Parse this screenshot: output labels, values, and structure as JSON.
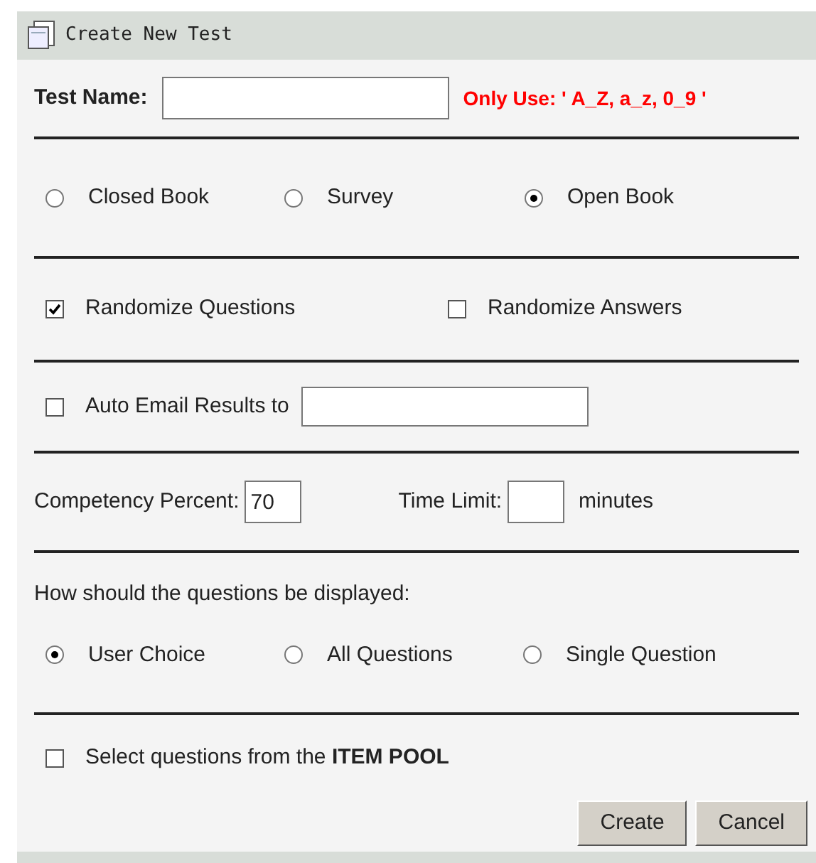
{
  "title": "Create New Test",
  "test_name": {
    "label": "Test Name:",
    "hint": "Only Use: ' A_Z, a_z, 0_9 '"
  },
  "test_types": [
    {
      "label": "Closed Book",
      "selected": false
    },
    {
      "label": "Survey",
      "selected": false
    },
    {
      "label": "Open Book",
      "selected": true
    }
  ],
  "randomize": [
    {
      "label": "Randomize Questions",
      "checked": true
    },
    {
      "label": "Randomize Answers",
      "checked": false
    }
  ],
  "auto_email": {
    "label": "Auto Email Results to",
    "checked": false
  },
  "competency": {
    "label": "Competency Percent:",
    "value": "70"
  },
  "time_limit": {
    "label": "Time Limit:",
    "unit": "minutes"
  },
  "display": {
    "prompt": "How should the questions be displayed:",
    "options": [
      {
        "label": "User Choice",
        "selected": true
      },
      {
        "label": "All Questions",
        "selected": false
      },
      {
        "label": "Single Question",
        "selected": false
      }
    ]
  },
  "item_pool": {
    "label": "Select questions from the **ITEM POOL**",
    "checked": false
  },
  "buttons": [
    "Create",
    "Cancel"
  ]
}
